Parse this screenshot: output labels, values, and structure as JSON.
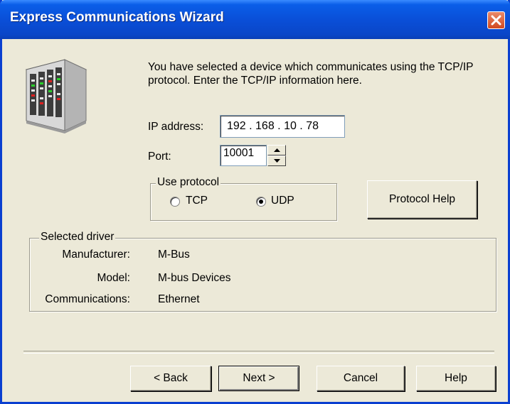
{
  "window": {
    "title": "Express Communications Wizard",
    "icon": "server-rack-icon"
  },
  "intro_text": "You have selected a device which communicates using the TCP/IP protocol. Enter the TCP/IP information here.",
  "ip": {
    "label": "IP address:",
    "value": "192 . 168 .  10  .  78"
  },
  "port": {
    "label": "Port:",
    "value": "10001"
  },
  "protocol": {
    "group_title": "Use protocol",
    "options": [
      {
        "label": "TCP",
        "selected": false
      },
      {
        "label": "UDP",
        "selected": true
      }
    ],
    "help_button": "Protocol Help"
  },
  "driver": {
    "group_title": "Selected driver",
    "rows": [
      {
        "key": "Manufacturer:",
        "value": "M-Bus"
      },
      {
        "key": "Model:",
        "value": "M-bus Devices"
      },
      {
        "key": "Communications:",
        "value": "Ethernet"
      }
    ]
  },
  "buttons": {
    "back": "< Back",
    "next": "Next >",
    "cancel": "Cancel",
    "help": "Help"
  },
  "colors": {
    "titlebar": "#0a4fd8",
    "dialog_bg": "#ece9d8",
    "close": "#d2491f"
  }
}
